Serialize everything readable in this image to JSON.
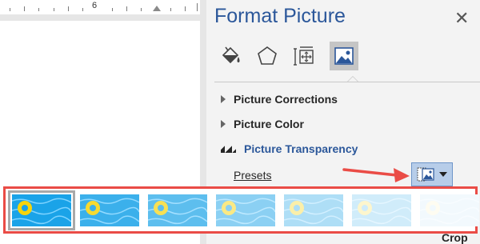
{
  "ruler": {
    "number": "6"
  },
  "pane": {
    "title": "Format Picture",
    "close_icon": "close-icon",
    "tabs": [
      {
        "name": "fill-line",
        "icon": "paint-bucket-icon"
      },
      {
        "name": "effects",
        "icon": "pentagon-icon"
      },
      {
        "name": "size-properties",
        "icon": "size-properties-icon"
      },
      {
        "name": "picture",
        "icon": "picture-icon",
        "active": true
      }
    ],
    "sections": [
      {
        "label": "Picture Corrections",
        "expanded": false
      },
      {
        "label": "Picture Color",
        "expanded": false
      },
      {
        "label": "Picture Transparency",
        "expanded": true
      }
    ],
    "presets_label": "Presets",
    "crop_label": "Crop"
  },
  "gallery": {
    "transparency_levels": [
      0,
      0.15,
      0.3,
      0.5,
      0.65,
      0.8,
      0.95
    ],
    "selected_index": 0
  },
  "colors": {
    "accent": "#2b579a",
    "highlight_border": "#ea4c46",
    "arrow": "#ea4c46",
    "water": "#1aa3e8",
    "float": "#f6d40c"
  }
}
